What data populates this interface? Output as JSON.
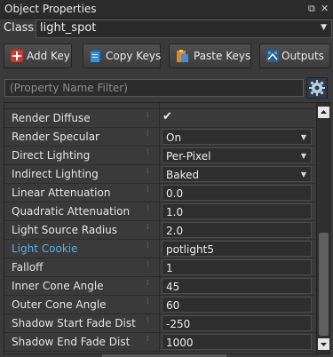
{
  "window": {
    "title": "Object Properties",
    "float_glyph": "⧉",
    "close_glyph": "✕"
  },
  "class_selector": {
    "label": "Class:",
    "value": "light_spot"
  },
  "toolbar": {
    "add_key": "Add Key",
    "copy_keys": "Copy Keys",
    "paste_keys": "Paste Keys",
    "outputs": "Outputs"
  },
  "filter": {
    "placeholder": "(Property Name Filter)"
  },
  "properties": [
    {
      "name": "Render Diffuse",
      "value": "✔",
      "kind": "checkbox",
      "checked": true
    },
    {
      "name": "Render Specular",
      "value": "On",
      "kind": "dropdown"
    },
    {
      "name": "Direct Lighting",
      "value": "Per-Pixel",
      "kind": "dropdown"
    },
    {
      "name": "Indirect Lighting",
      "value": "Baked",
      "kind": "dropdown"
    },
    {
      "name": "Linear Attenuation",
      "value": "0.0",
      "kind": "text"
    },
    {
      "name": "Quadratic Attenuation",
      "value": "1.0",
      "kind": "text"
    },
    {
      "name": "Light Source Radius",
      "value": "2.0",
      "kind": "text"
    },
    {
      "name": "Light Cookie",
      "value": "potlight5",
      "kind": "text",
      "link": true
    },
    {
      "name": "Falloff",
      "value": "1",
      "kind": "text"
    },
    {
      "name": "Inner Cone Angle",
      "value": "45",
      "kind": "text"
    },
    {
      "name": "Outer Cone Angle",
      "value": "60",
      "kind": "text"
    },
    {
      "name": "Shadow Start Fade Dist",
      "value": "-250",
      "kind": "text"
    },
    {
      "name": "Shadow End Fade Dist",
      "value": "1000",
      "kind": "text"
    }
  ],
  "colors": {
    "link": "#57b0e6",
    "panel_bg": "#3a3a3a",
    "add_icon": "#d9342b",
    "copy_icon": "#3b8fd6",
    "paste_icon": "#d88a2a",
    "outputs_icon": "#4aa3e0"
  },
  "icons": {
    "add_key": "plus-icon",
    "copy_keys": "copy-icon",
    "paste_keys": "paste-icon",
    "outputs": "outputs-icon",
    "filter_options": "gear-icon"
  }
}
